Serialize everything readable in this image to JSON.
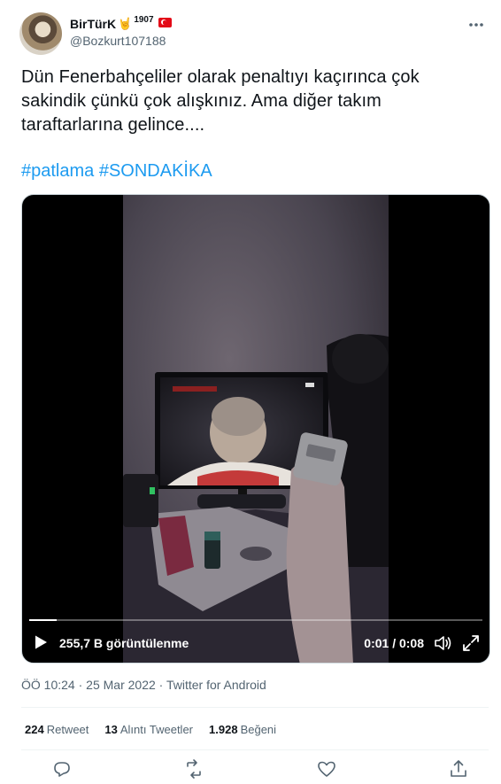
{
  "author": {
    "display_name": "BirTürK",
    "badge_emoji": "🤘",
    "badge_year": "1907",
    "flag": "turkey-flag",
    "handle": "@Bozkurt107188"
  },
  "tweet": {
    "text": "Dün Fenerbahçeliler olarak penaltıyı kaçırınca çok sakindik çünkü çok alışkınız. Ama diğer takım taraftarlarına gelince....",
    "hashtags": [
      "#patlama",
      "#SONDAKİKA"
    ]
  },
  "video": {
    "views": "255,7 B görüntülenme",
    "timecode": "0:01 / 0:08",
    "progress": 0.06,
    "icons": [
      "play-icon",
      "volume-icon",
      "fullscreen-icon"
    ]
  },
  "meta": {
    "time": "ÖÖ 10:24",
    "separator1": "·",
    "date": "25 Mar 2022",
    "separator2": "·",
    "source": "Twitter for Android"
  },
  "stats": [
    {
      "count": "224",
      "label": "Retweet"
    },
    {
      "count": "13",
      "label": "Alıntı Tweetler"
    },
    {
      "count": "1.928",
      "label": "Beğeni"
    }
  ],
  "actions": [
    "reply-icon",
    "retweet-icon",
    "like-icon",
    "share-icon"
  ],
  "colors": {
    "accent": "#1d9bf0",
    "text": "#0f1419",
    "secondary": "#536471"
  }
}
